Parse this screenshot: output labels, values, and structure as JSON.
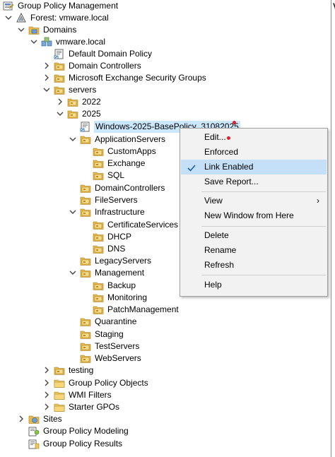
{
  "colors": {
    "folder": "#e8b94a",
    "selection": "#cce8ff",
    "menu_highlight": "#c4e0f8",
    "check": "#1a5fa8",
    "marker": "#e0202a"
  },
  "tree": {
    "root": {
      "label": "Group Policy Management",
      "icon": "gpm-console-icon"
    },
    "forest": {
      "label": "Forest: vmware.local",
      "icon": "forest-icon"
    },
    "domains": {
      "label": "Domains",
      "icon": "domains-folder-icon"
    },
    "domain": {
      "label": "vmware.local",
      "icon": "domain-icon"
    },
    "default_domain_policy": {
      "label": "Default Domain Policy",
      "icon": "gpo-link-icon"
    },
    "domain_controllers": {
      "label": "Domain Controllers",
      "icon": "ou-folder-icon"
    },
    "exchange_groups": {
      "label": "Microsoft Exchange Security Groups",
      "icon": "ou-folder-icon"
    },
    "servers": {
      "label": "servers",
      "icon": "ou-folder-icon"
    },
    "ou_2022": {
      "label": "2022",
      "icon": "ou-folder-icon"
    },
    "ou_2025": {
      "label": "2025",
      "icon": "ou-folder-icon"
    },
    "gpo_link": {
      "label": "Windows-2025-BasePolicy_31082025",
      "icon": "gpo-link-icon"
    },
    "application_servers": {
      "label": "ApplicationServers",
      "icon": "ou-folder-icon"
    },
    "custom_apps": {
      "label": "CustomApps",
      "icon": "ou-folder-icon"
    },
    "exchange": {
      "label": "Exchange",
      "icon": "ou-folder-icon"
    },
    "sql": {
      "label": "SQL",
      "icon": "ou-folder-icon"
    },
    "domain_controllers_ou": {
      "label": "DomainControllers",
      "icon": "ou-folder-icon"
    },
    "file_servers": {
      "label": "FileServers",
      "icon": "ou-folder-icon"
    },
    "infrastructure": {
      "label": "Infrastructure",
      "icon": "ou-folder-icon"
    },
    "certificate_services": {
      "label": "CertificateServices",
      "icon": "ou-folder-icon"
    },
    "dhcp": {
      "label": "DHCP",
      "icon": "ou-folder-icon"
    },
    "dns": {
      "label": "DNS",
      "icon": "ou-folder-icon"
    },
    "legacy_servers": {
      "label": "LegacyServers",
      "icon": "ou-folder-icon"
    },
    "management": {
      "label": "Management",
      "icon": "ou-folder-icon"
    },
    "backup": {
      "label": "Backup",
      "icon": "ou-folder-icon"
    },
    "monitoring": {
      "label": "Monitoring",
      "icon": "ou-folder-icon"
    },
    "patch_management": {
      "label": "PatchManagement",
      "icon": "ou-folder-icon"
    },
    "quarantine": {
      "label": "Quarantine",
      "icon": "ou-folder-icon"
    },
    "staging": {
      "label": "Staging",
      "icon": "ou-folder-icon"
    },
    "test_servers": {
      "label": "TestServers",
      "icon": "ou-folder-icon"
    },
    "web_servers": {
      "label": "WebServers",
      "icon": "ou-folder-icon"
    },
    "testing": {
      "label": "testing",
      "icon": "ou-folder-icon"
    },
    "gpo_objects": {
      "label": "Group Policy Objects",
      "icon": "folder-icon"
    },
    "wmi_filters": {
      "label": "WMI Filters",
      "icon": "folder-icon"
    },
    "starter_gpos": {
      "label": "Starter GPOs",
      "icon": "folder-icon"
    },
    "sites": {
      "label": "Sites",
      "icon": "sites-icon"
    },
    "modeling": {
      "label": "Group Policy Modeling",
      "icon": "modeling-icon"
    },
    "results": {
      "label": "Group Policy Results",
      "icon": "results-icon"
    }
  },
  "right_pane": {
    "cut_text": "V"
  },
  "context_menu": {
    "edit": "Edit...",
    "enforced": "Enforced",
    "link_enabled": "Link Enabled",
    "link_enabled_checked": true,
    "save_report": "Save Report...",
    "view": "View",
    "new_window": "New Window from Here",
    "delete": "Delete",
    "rename": "Rename",
    "refresh": "Refresh",
    "help": "Help"
  }
}
